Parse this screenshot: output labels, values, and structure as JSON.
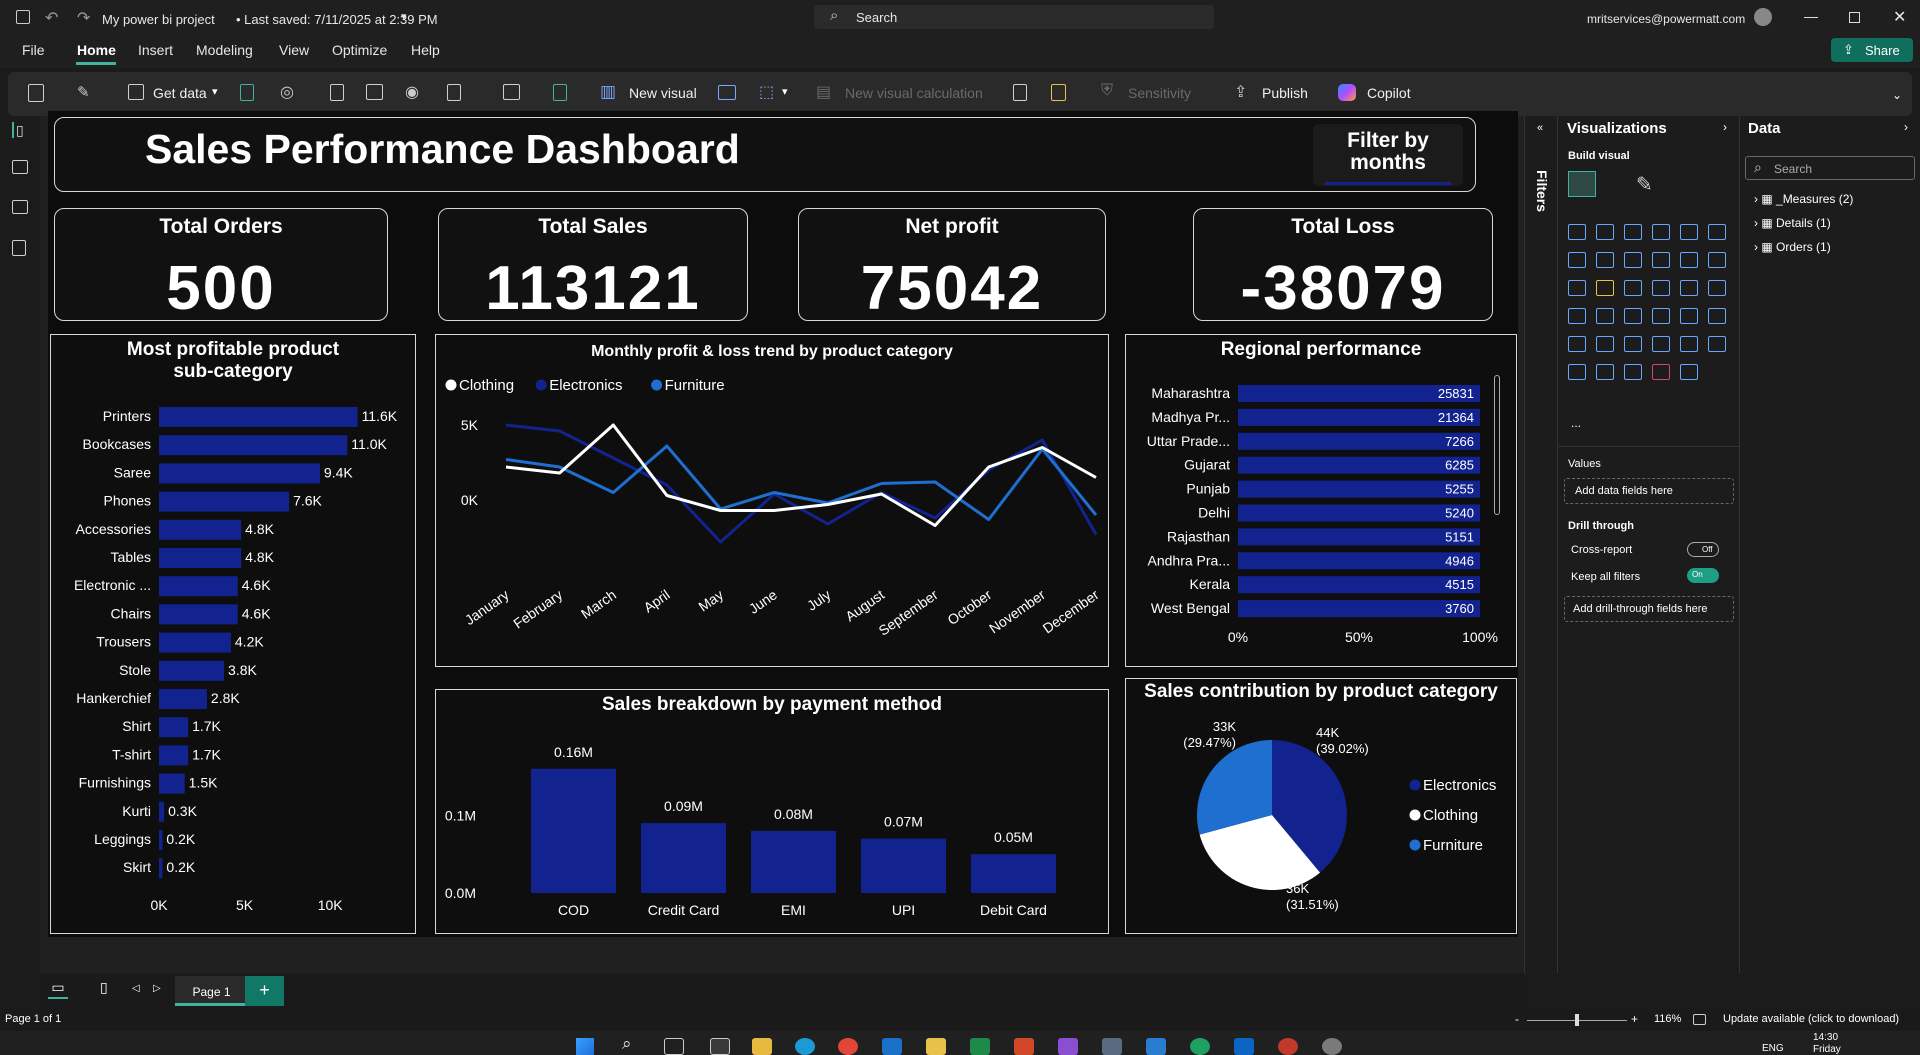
{
  "titlebar": {
    "title": "My power bi project",
    "saved": "• Last saved: 7/11/2025 at 2:39 PM",
    "search_placeholder": "Search",
    "account": "mritservices@powermatt.com",
    "share": "Share"
  },
  "menu": [
    "File",
    "Home",
    "Insert",
    "Modeling",
    "View",
    "Optimize",
    "Help"
  ],
  "ribbon": {
    "get_data": "Get data",
    "new_visual": "New visual",
    "new_visual_calc": "New visual calculation",
    "sensitivity": "Sensitivity",
    "publish": "Publish",
    "copilot": "Copilot"
  },
  "dashboard": {
    "title": "Sales Performance Dashboard",
    "filter_label": "Filter by months",
    "kpis": [
      {
        "label": "Total Orders",
        "value": "500"
      },
      {
        "label": "Total Sales",
        "value": "113121"
      },
      {
        "label": "Net profit",
        "value": "75042"
      },
      {
        "label": "Total Loss",
        "value": "-38079"
      }
    ]
  },
  "chart_data": [
    {
      "type": "bar",
      "title": "Most profitable product sub-category",
      "orientation": "horizontal",
      "color": "#12238f",
      "categories": [
        "Printers",
        "Bookcases",
        "Saree",
        "Phones",
        "Accessories",
        "Tables",
        "Electronic ...",
        "Chairs",
        "Trousers",
        "Stole",
        "Hankerchief",
        "Shirt",
        "T-shirt",
        "Furnishings",
        "Kurti",
        "Leggings",
        "Skirt"
      ],
      "values": [
        11600,
        11000,
        9400,
        7600,
        4800,
        4800,
        4600,
        4600,
        4200,
        3800,
        2800,
        1700,
        1700,
        1500,
        300,
        200,
        200
      ],
      "labels": [
        "11.6K",
        "11.0K",
        "9.4K",
        "7.6K",
        "4.8K",
        "4.8K",
        "4.6K",
        "4.6K",
        "4.2K",
        "3.8K",
        "2.8K",
        "1.7K",
        "1.7K",
        "1.5K",
        "0.3K",
        "0.2K",
        "0.2K"
      ],
      "xticks": [
        "0K",
        "5K",
        "10K"
      ],
      "xlim": [
        0,
        11800
      ]
    },
    {
      "type": "line",
      "title": "Monthly profit & loss trend by product category",
      "categories": [
        "January",
        "February",
        "March",
        "April",
        "May",
        "June",
        "July",
        "August",
        "September",
        "October",
        "November",
        "December"
      ],
      "yticks": [
        "5K",
        "0K"
      ],
      "ylim": [
        -3000,
        6000
      ],
      "legend_position": "top-left",
      "series": [
        {
          "name": "Clothing",
          "color": "#ffffff",
          "values": [
            2200,
            1800,
            5000,
            300,
            -700,
            -700,
            -300,
            400,
            -1700,
            2200,
            3500,
            1500
          ]
        },
        {
          "name": "Electronics",
          "color": "#12238f",
          "values": [
            5000,
            4600,
            2800,
            1000,
            -2800,
            400,
            -1600,
            500,
            -1200,
            2000,
            4000,
            -2300
          ]
        },
        {
          "name": "Furniture",
          "color": "#1f6fd1",
          "values": [
            2700,
            2200,
            500,
            3600,
            -600,
            500,
            -200,
            1100,
            1200,
            -1300,
            3400,
            -1000
          ]
        }
      ]
    },
    {
      "type": "bar",
      "title": "Regional performance",
      "orientation": "horizontal",
      "stacked_percent": true,
      "color": "#12238f",
      "categories": [
        "Maharashtra",
        "Madhya Pr...",
        "Uttar Prade...",
        "Gujarat",
        "Punjab",
        "Delhi",
        "Rajasthan",
        "Andhra Pra...",
        "Kerala",
        "West Bengal"
      ],
      "values": [
        25831,
        21364,
        7266,
        6285,
        5255,
        5240,
        5151,
        4946,
        4515,
        3760
      ],
      "xticks": [
        "0%",
        "50%",
        "100%"
      ]
    },
    {
      "type": "bar",
      "title": "Sales breakdown by payment method",
      "color": "#12238f",
      "categories": [
        "COD",
        "Credit Card",
        "EMI",
        "UPI",
        "Debit Card"
      ],
      "values": [
        0.16,
        0.09,
        0.08,
        0.07,
        0.05
      ],
      "labels": [
        "0.16M",
        "0.09M",
        "0.08M",
        "0.07M",
        "0.05M"
      ],
      "yticks": [
        "0.1M",
        "0.0M"
      ],
      "ylim": [
        0,
        0.17
      ]
    },
    {
      "type": "pie",
      "title": "Sales contribution by product category",
      "legend_position": "right",
      "slices": [
        {
          "name": "Electronics",
          "value": 44,
          "label": "44K",
          "pct": "(39.02%)",
          "color": "#12238f"
        },
        {
          "name": "Clothing",
          "value": 36,
          "label": "36K",
          "pct": "(31.51%)",
          "color": "#ffffff"
        },
        {
          "name": "Furniture",
          "value": 33,
          "label": "33K",
          "pct": "(29.47%)",
          "color": "#1f6fd1"
        }
      ]
    }
  ],
  "filters_label": "Filters",
  "visualizations": {
    "title": "Visualizations",
    "build": "Build visual",
    "values_label": "Values",
    "add_data": "Add data fields here",
    "drill_through": "Drill through",
    "cross_report": "Cross-report",
    "cross_report_state": "Off",
    "keep_filters": "Keep all filters",
    "keep_filters_state": "On",
    "add_drill": "Add drill-through fields here",
    "more": "..."
  },
  "data_pane": {
    "title": "Data",
    "search_placeholder": "Search",
    "tables": [
      "_Measures (2)",
      "Details (1)",
      "Orders (1)"
    ]
  },
  "pages": {
    "tab": "Page 1",
    "add": "+"
  },
  "status": {
    "page": "Page 1 of 1",
    "zoom": "116%",
    "update": "Update available (click to download)",
    "zoom_minus": "-",
    "zoom_plus": "+"
  },
  "taskbar": {
    "time": "14:30",
    "day": "Friday",
    "lang": "ENG"
  }
}
